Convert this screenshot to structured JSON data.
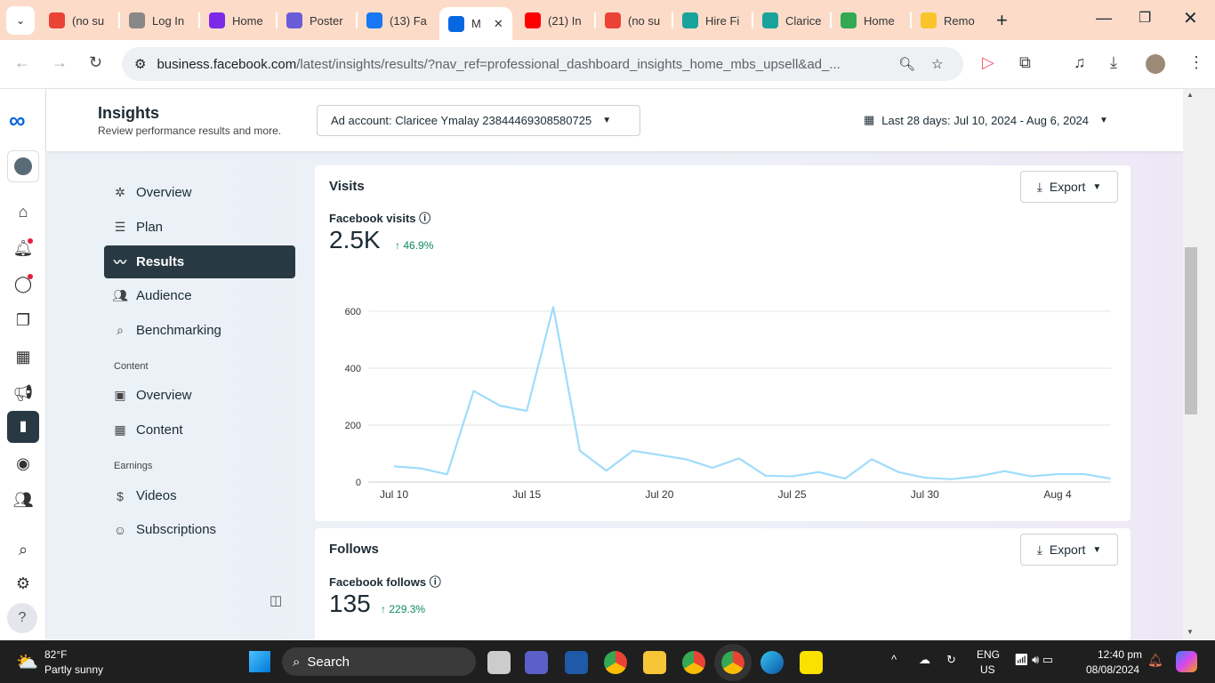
{
  "browser": {
    "tabs": [
      {
        "label": "(no su",
        "icon": "gmail-icon",
        "color": "#ea4335"
      },
      {
        "label": "Log In",
        "icon": "loading-icon",
        "color": "#888"
      },
      {
        "label": "Home",
        "icon": "canva-icon",
        "color": "#7d2ae8"
      },
      {
        "label": "Poster",
        "icon": "printer-icon",
        "color": "#6a5cd8"
      },
      {
        "label": "(13) Fa",
        "icon": "facebook-icon",
        "color": "#1877f2"
      },
      {
        "label": "M",
        "icon": "meta-icon",
        "color": "#0668e1"
      },
      {
        "label": "(21) In",
        "icon": "youtube-icon",
        "color": "#ff0000"
      },
      {
        "label": "(no su",
        "icon": "gmail-icon",
        "color": "#ea4335"
      },
      {
        "label": "Hire Fi",
        "icon": "pencil-icon",
        "color": "#1aa39a"
      },
      {
        "label": "Clarice",
        "icon": "pencil-icon",
        "color": "#1aa39a"
      },
      {
        "label": "Home",
        "icon": "drive-icon",
        "color": "#34a853"
      },
      {
        "label": "Remo",
        "icon": "remove-bg-icon",
        "color": "#f9c52b"
      }
    ],
    "url_host": "business.facebook.com",
    "url_path": "/latest/insights/results/?nav_ref=professional_dashboard_insights_home_mbs_upsell&ad_..."
  },
  "header": {
    "title": "Insights",
    "subtitle": "Review performance results and more.",
    "ad_account": "Ad account: Claricee Ymalay 23844469308580725",
    "date_range": "Last 28 days: Jul 10, 2024 - Aug 6, 2024"
  },
  "sidebar": {
    "items": [
      {
        "label": "Overview",
        "icon": "overview-icon"
      },
      {
        "label": "Plan",
        "icon": "plan-list-icon"
      },
      {
        "label": "Results",
        "icon": "results-chart-icon"
      },
      {
        "label": "Audience",
        "icon": "audience-icon"
      },
      {
        "label": "Benchmarking",
        "icon": "benchmark-icon"
      }
    ],
    "content_heading": "Content",
    "content_items": [
      {
        "label": "Overview"
      },
      {
        "label": "Content"
      }
    ],
    "earnings_heading": "Earnings",
    "earnings_items": [
      {
        "label": "Videos"
      },
      {
        "label": "Subscriptions"
      }
    ]
  },
  "visits": {
    "title": "Visits",
    "export": "Export",
    "metric_label": "Facebook visits",
    "value": "2.5K",
    "change": "46.9%"
  },
  "follows": {
    "title": "Follows",
    "export": "Export",
    "metric_label": "Facebook follows",
    "value": "135",
    "change": "229.3%"
  },
  "chart_data": {
    "type": "line",
    "title": "Facebook visits",
    "xlabel": "",
    "ylabel": "",
    "ylim": [
      0,
      600
    ],
    "yticks": [
      "0",
      "200",
      "400",
      "600"
    ],
    "xticks": [
      "Jul 10",
      "Jul 15",
      "Jul 20",
      "Jul 25",
      "Jul 30",
      "Aug 4"
    ],
    "x": [
      "Jul 10",
      "Jul 11",
      "Jul 12",
      "Jul 13",
      "Jul 14",
      "Jul 15",
      "Jul 16",
      "Jul 17",
      "Jul 18",
      "Jul 19",
      "Jul 20",
      "Jul 21",
      "Jul 22",
      "Jul 23",
      "Jul 24",
      "Jul 25",
      "Jul 26",
      "Jul 27",
      "Jul 28",
      "Jul 29",
      "Jul 30",
      "Jul 31",
      "Aug 1",
      "Aug 2",
      "Aug 3",
      "Aug 4",
      "Aug 5",
      "Aug 6"
    ],
    "values": [
      55,
      48,
      27,
      320,
      268,
      250,
      615,
      110,
      40,
      110,
      95,
      80,
      50,
      83,
      22,
      20,
      35,
      12,
      80,
      35,
      15,
      10,
      20,
      38,
      20,
      28,
      28,
      12
    ],
    "color": "#9fdcfb",
    "grid": true
  },
  "taskbar": {
    "temp": "82°F",
    "weather": "Partly sunny",
    "search": "Search",
    "lang1": "ENG",
    "lang2": "US",
    "time": "12:40 pm",
    "date": "08/08/2024"
  }
}
